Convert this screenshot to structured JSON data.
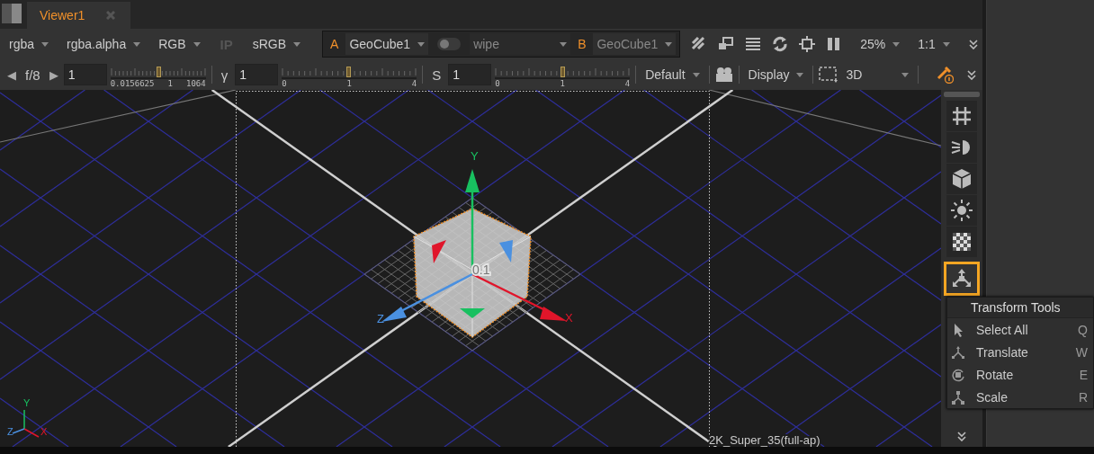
{
  "tabs": [
    {
      "label": "Viewer1",
      "selected": true
    }
  ],
  "toolbar_top": {
    "channels": "rgba",
    "layer": "rgba.alpha",
    "display_channels": "RGB",
    "ip": {
      "label": "IP",
      "disabled": true
    },
    "lut": "sRGB",
    "input_a": {
      "letter": "A",
      "value": "GeoCube1",
      "active": true
    },
    "wipe": {
      "on": false,
      "mode": "wipe"
    },
    "input_b": {
      "letter": "B",
      "value": "GeoCube1",
      "active": false
    },
    "zoom": "25%",
    "proxy": "1:1"
  },
  "toolbar_bottom": {
    "sliders": [
      {
        "kind": "fstop",
        "prev": "◀",
        "label": "f/8",
        "next": "▶",
        "value": "1",
        "level": 0.5,
        "tick_labels": [
          "0.0156625",
          "1",
          "1064"
        ]
      },
      {
        "kind": "plain",
        "label": "γ",
        "value": "1",
        "level": 0.49,
        "tick_labels": [
          "0",
          "1",
          "4"
        ]
      },
      {
        "kind": "plain",
        "label": "S",
        "value": "1",
        "level": 0.5,
        "tick_labels": [
          "0",
          "1",
          "4"
        ]
      }
    ],
    "lut_mode": "Default",
    "display": "Display",
    "view_mode": "3D"
  },
  "viewport": {
    "gizmo_labels": {
      "y": "Y",
      "x": "X",
      "z": "Z"
    },
    "handle_value": "0.1",
    "corner_axes": {
      "y": "Y",
      "x": "X",
      "z": "Z"
    },
    "format_label": "2K_Super_35(full-ap)"
  },
  "tool_strip": {
    "buttons": [
      {
        "kind": "grid",
        "selected": false
      },
      {
        "kind": "light",
        "selected": false
      },
      {
        "kind": "cube",
        "selected": false
      },
      {
        "kind": "sun",
        "selected": false
      },
      {
        "kind": "checker",
        "selected": false
      },
      {
        "kind": "transform",
        "selected": true
      }
    ]
  },
  "menu": {
    "title": "Transform Tools",
    "items": [
      {
        "kind": "select",
        "label": "Select All",
        "shortcut": "Q"
      },
      {
        "kind": "translate",
        "label": "Translate",
        "shortcut": "W"
      },
      {
        "kind": "rotate",
        "label": "Rotate",
        "shortcut": "E"
      },
      {
        "kind": "scale",
        "label": "Scale",
        "shortcut": "R"
      }
    ]
  }
}
